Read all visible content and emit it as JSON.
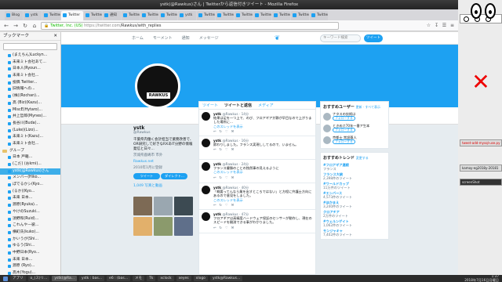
{
  "window": {
    "title": "ystk(@Rawkus)さん | Twitterから返信付きツイート - Mozilla Firefox"
  },
  "browser": {
    "tabs": [
      "Blog",
      "ystk",
      "Twitter",
      "Twitter",
      "Twitter",
      "通知",
      "Twitter",
      "Twitter",
      "Twitter",
      "ystk",
      "Twitter",
      "Twitter",
      "Twitter",
      "Twitter",
      "Twitter",
      "Twitter",
      "Twitter"
    ],
    "active_tab_index": 3,
    "url_identity": "Twitter, Inc. (US)",
    "url_host": "https://twitter.com",
    "url_path": "/Rawkus/with_replies"
  },
  "sidebar": {
    "title": "ブックマーク",
    "items": [
      {
        "label": "(まえちん)Luckyn...",
        "folder": false
      },
      {
        "label": "未来ミト会社あて...",
        "folder": false
      },
      {
        "label": "日本人(Ryoun...",
        "folder": false
      },
      {
        "label": "未来ミト会社...",
        "folder": false
      },
      {
        "label": "投稿 Twitter...",
        "folder": false
      },
      {
        "label": "旧情報への...",
        "folder": false
      },
      {
        "label": "(株)(Rochan)...",
        "folder": false
      },
      {
        "label": "高 (Biz)(Kazu)...",
        "folder": false
      },
      {
        "label": "MiscE(Hytaro)...",
        "folder": false
      },
      {
        "label": "井上哲郎(Mynes)...",
        "folder": false
      },
      {
        "label": "長谷川(Buda)...",
        "folder": false
      },
      {
        "label": "(Luke)(Lizo)...",
        "folder": false
      },
      {
        "label": "未来ミト(Kazu)...",
        "folder": false
      },
      {
        "label": "未来ミト会社...",
        "folder": false
      },
      {
        "label": "グループ",
        "folder": true
      },
      {
        "label": "日本 戸籍...",
        "folder": false
      },
      {
        "label": "(こだ) (おkmi)...",
        "folder": false
      },
      {
        "label": "ystk(@Rawkus)さん",
        "folder": false,
        "selected": true
      },
      {
        "label": "メンバー(Hiko...",
        "folder": false
      },
      {
        "label": "ぽでるかシ(Kyo...",
        "folder": false
      },
      {
        "label": "(るか)(Kyo...",
        "folder": false
      },
      {
        "label": "未来 日本...",
        "folder": false
      },
      {
        "label": "源原(Ryuka)...",
        "folder": false
      },
      {
        "label": "やけのSuzuki...",
        "folder": false
      },
      {
        "label": "須野和(Ruid)...",
        "folder": false
      },
      {
        "label": "これんやー彼...",
        "folder": false
      },
      {
        "label": "横町氏(kuko)...",
        "folder": false
      },
      {
        "label": "かいうが(Shi...",
        "folder": false
      },
      {
        "label": "ゆるう(Shi...",
        "folder": false
      },
      {
        "label": "中野日本(Ryo...",
        "folder": false
      },
      {
        "label": "未来 日本...",
        "folder": false
      },
      {
        "label": "源原 (Ryo)...",
        "folder": false
      },
      {
        "label": "高木(Yogu)...",
        "folder": false
      },
      {
        "label": "未来ミト(kei)...",
        "folder": false
      }
    ]
  },
  "twitter": {
    "nav": [
      "ホーム",
      "モーメント",
      "通知",
      "メッセージ"
    ],
    "search_placeholder": "キーワード検索",
    "tweet_button": "ツイート",
    "avatar_text": "RAWKUS",
    "stats": [
      {
        "label": "ツイート",
        "value": "143,786"
      },
      {
        "label": "フォロー",
        "value": "992"
      },
      {
        "label": "フォロワー",
        "value": "27,203"
      },
      {
        "label": "いいね",
        "value": "6,278"
      }
    ],
    "follow_button": "フォローする",
    "profile": {
      "name": "ystk",
      "handle": "@Rawkus",
      "bio": "千葉県内働く会計担当で業務改善で、OR研究して好きなRXあIT分野の情報発信と日々...",
      "location": "茨城県鹿嶋市 市外",
      "link": "Rawkus.net",
      "joined": "2010年1月に登録",
      "btn_tweet": "ツイート",
      "btn_dm": "ダイレクト..."
    },
    "photos_label": "1,049 写真と動画",
    "tabs": [
      "ツイート",
      "ツイートと返信",
      "メディア"
    ],
    "tweets": [
      {
        "name": "ystk",
        "handle": "@Rawkus · 14分",
        "text": "結果は足を一つ上で、のび、フロアギアが静が早目なので上がりました場所に...",
        "thread": "このスレッドを表示"
      },
      {
        "name": "ystk",
        "handle": "@Rawkus · 16分",
        "text": "節わりしました。フランス実現ししてるので、いません。",
        "thread": ""
      },
      {
        "name": "ystk",
        "handle": "@Rawkus · 24分",
        "text": "フランス優勝のことの独然事の見えるように",
        "thread": "このスレッドを表示"
      },
      {
        "name": "ystk",
        "handle": "@Rawkus · 40分",
        "text": "「概要ってんなら業を出すところではない」と方程に弁護士方向にあるので意見をしました。",
        "thread": "このスレッドを表示"
      },
      {
        "name": "ystk",
        "handle": "@Rawkus · 47分",
        "text": "フロアギアは高精度ハードウェア保証のセンサーが動作し、現在のスピードを観測できる事がわかりました。",
        "thread": ""
      }
    ],
    "suggest_title": "おすすめユーザー",
    "suggest_more": "更新 · すべて表示",
    "suggestions": [
      {
        "name": "ナタスの技術は",
        "handle": "@...",
        "button": "フォローする"
      },
      {
        "name": "ときめけ70年一番ア生本",
        "handle": "@...",
        "button": "フォローする"
      },
      {
        "name": "京都士 常設尊人",
        "handle": "@...",
        "button": "フォローする"
      }
    ],
    "trends_title": "おすすめトレンド",
    "trends_more": "変更する",
    "trends": [
      {
        "tag": "#フロアギア連続",
        "count": "フランス"
      },
      {
        "tag": "フランス大統",
        "count": "2,398件のツイート"
      },
      {
        "tag": "#ワールドカップ",
        "count": "11万件のツイート"
      },
      {
        "tag": "#エンバース",
        "count": "4,573件のツイート"
      },
      {
        "tag": "#ほかまえ",
        "count": "3,240件のツイート"
      },
      {
        "tag": "クロアチア",
        "count": "2万件のツイート"
      },
      {
        "tag": "#ウェルンゲイト",
        "count": "1,062件のツイート"
      },
      {
        "tag": "モンジャキャ",
        "count": "7,402件のツイート"
      }
    ]
  },
  "desktop": {
    "terminal_red": "tweet-add-mysql-use.py",
    "terminal_2": "kamoy-eg2018y-20181",
    "terminal_3": "screenShot"
  },
  "taskbar": {
    "items": [
      "アプリ",
      "o_(ス)リ...",
      "ystk(@Ra...",
      "ystk : bas...",
      "e6 : (bas...",
      "メモ",
      "Tk",
      "xclock",
      "xeyes",
      "xlogo",
      "ystk@Rawkus..."
    ],
    "time": "1:37",
    "date": "2018年7月16日月曜日"
  }
}
